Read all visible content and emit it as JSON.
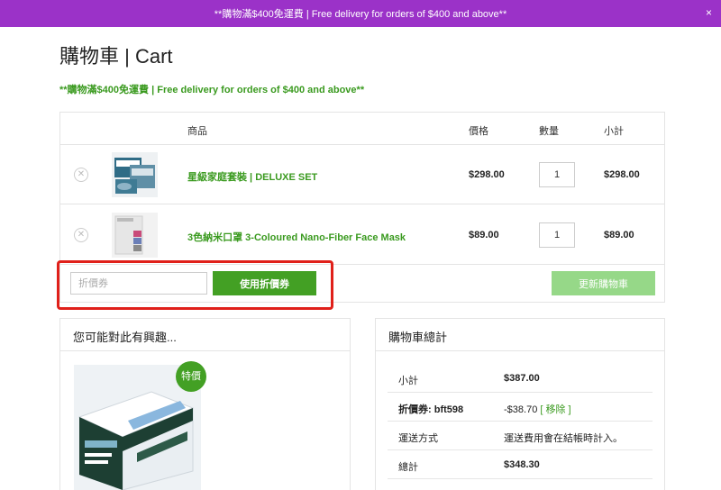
{
  "banner": {
    "text": "**購物滿$400免運費 | Free delivery for orders of $400 and above**",
    "close": "×"
  },
  "page": {
    "title": "購物車 | Cart",
    "notice": "**購物滿$400免運費 | Free delivery for orders of $400 and above**"
  },
  "cart": {
    "headers": {
      "product": "商品",
      "price": "價格",
      "quantity": "數量",
      "subtotal": "小計"
    },
    "items": [
      {
        "name": "星級家庭套裝 | DELUXE SET",
        "price": "$298.00",
        "quantity": "1",
        "subtotal": "$298.00"
      },
      {
        "name": "3色納米口罩 3-Coloured Nano-Fiber Face Mask",
        "price": "$89.00",
        "quantity": "1",
        "subtotal": "$89.00"
      }
    ],
    "coupon_placeholder": "折價券",
    "apply_coupon": "使用折價券",
    "update_cart": "更新購物車"
  },
  "cross_sells": {
    "title": "您可能對此有興趣...",
    "badge": "特價"
  },
  "totals": {
    "title": "購物車總計",
    "rows": [
      {
        "label": "小計",
        "value": "$387.00"
      },
      {
        "label": "折價券: bft598",
        "value": "-$38.70",
        "link": "[ 移除 ]"
      },
      {
        "label": "運送方式",
        "value": "運送費用會在結帳時計入。"
      },
      {
        "label": "總計",
        "value": "$348.30"
      }
    ]
  },
  "colors": {
    "banner": "#9b32c8",
    "accent_green": "#43a024",
    "link_green": "#3a9a1f",
    "highlight_red": "#e0201a",
    "disabled_green": "#96d888"
  },
  "icons": [
    "remove-icon",
    "close-icon"
  ]
}
